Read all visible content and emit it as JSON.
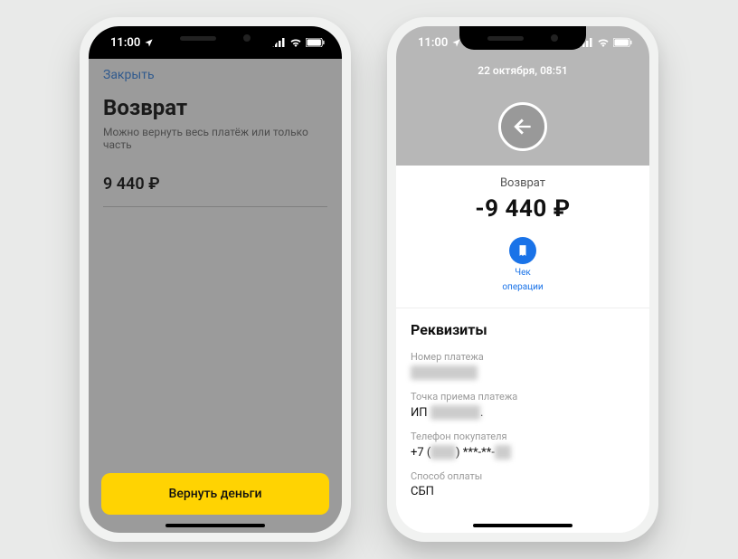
{
  "statusbar": {
    "time": "11:00",
    "location_icon": "▸"
  },
  "screen1": {
    "close": "Закрыть",
    "title": "Возврат",
    "subtitle": "Можно вернуть весь платёж или только часть",
    "amount": "9 440 ₽",
    "button": "Вернуть деньги"
  },
  "screen2": {
    "date": "22 октября, 08:51",
    "operation_label": "Возврат",
    "amount": "-9 440 ₽",
    "receipt": {
      "line1": "Чек",
      "line2": "операции"
    },
    "details_title": "Реквизиты",
    "rows": {
      "payment_number_label": "Номер платежа",
      "payment_number_value": "████████",
      "point_label": "Точка приема платежа",
      "point_value_prefix": "ИП ",
      "point_value_blur": "██████",
      "point_value_suffix": ".",
      "phone_label": "Телефон покупателя",
      "phone_value_prefix": "+7 (",
      "phone_value_blur1": "███",
      "phone_value_mid": ") ***-**-",
      "phone_value_blur2": "██",
      "method_label": "Способ оплаты",
      "method_value": "СБП"
    }
  }
}
